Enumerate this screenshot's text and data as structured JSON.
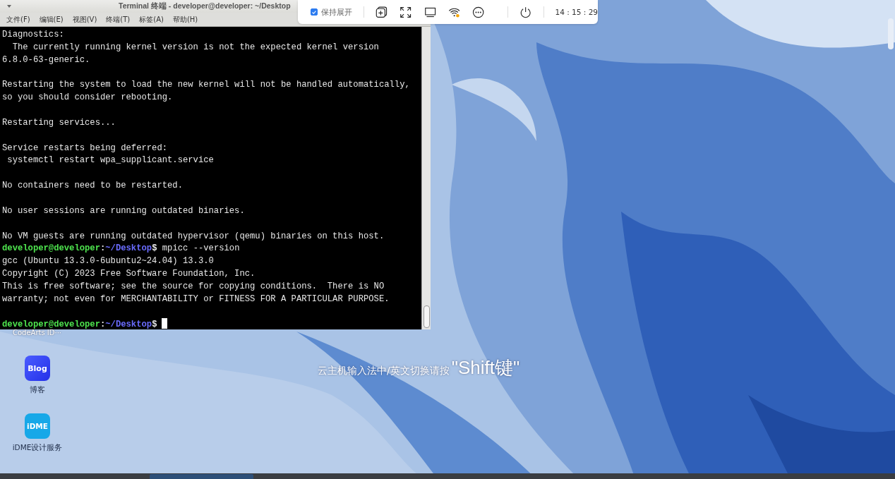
{
  "window": {
    "title": "Terminal 终端 - developer@developer: ~/Desktop",
    "menu": [
      "文件(F)",
      "编辑(E)",
      "视图(V)",
      "终端(T)",
      "标签(A)",
      "帮助(H)"
    ]
  },
  "terminal": {
    "lines": [
      {
        "kind": "text",
        "text": "Diagnostics:"
      },
      {
        "kind": "text",
        "text": "  The currently running kernel version is not the expected kernel version"
      },
      {
        "kind": "text",
        "text": "6.8.0-63-generic."
      },
      {
        "kind": "blank"
      },
      {
        "kind": "text",
        "text": "Restarting the system to load the new kernel will not be handled automatically,"
      },
      {
        "kind": "text",
        "text": "so you should consider rebooting."
      },
      {
        "kind": "blank"
      },
      {
        "kind": "text",
        "text": "Restarting services..."
      },
      {
        "kind": "blank"
      },
      {
        "kind": "text",
        "text": "Service restarts being deferred:"
      },
      {
        "kind": "text",
        "text": " systemctl restart wpa_supplicant.service"
      },
      {
        "kind": "blank"
      },
      {
        "kind": "text",
        "text": "No containers need to be restarted."
      },
      {
        "kind": "blank"
      },
      {
        "kind": "text",
        "text": "No user sessions are running outdated binaries."
      },
      {
        "kind": "blank"
      },
      {
        "kind": "text",
        "text": "No VM guests are running outdated hypervisor (qemu) binaries on this host."
      },
      {
        "kind": "prompt",
        "user": "developer@developer",
        "sep": ":",
        "path": "~/Desktop",
        "symbol": "$",
        "command": "mpicc --version"
      },
      {
        "kind": "text",
        "text": "gcc (Ubuntu 13.3.0-6ubuntu2~24.04) 13.3.0"
      },
      {
        "kind": "text",
        "text": "Copyright (C) 2023 Free Software Foundation, Inc."
      },
      {
        "kind": "text",
        "text": "This is free software; see the source for copying conditions.  There is NO"
      },
      {
        "kind": "text",
        "text": "warranty; not even for MERCHANTABILITY or FITNESS FOR A PARTICULAR PURPOSE."
      },
      {
        "kind": "blank"
      },
      {
        "kind": "prompt",
        "user": "developer@developer",
        "sep": ":",
        "path": "~/Desktop",
        "symbol": "$",
        "cursor": true
      }
    ]
  },
  "toolbar": {
    "keep_expanded": {
      "label": "保持展开",
      "checked": true
    },
    "clock": "14 : 15 : 29"
  },
  "desktop": {
    "hidden_icon_label": "CodeArts ID···",
    "icons": [
      {
        "kind": "blog",
        "glyph": "Blog",
        "label": "博客"
      },
      {
        "kind": "idme",
        "glyph": "iDME",
        "label": "iDME设计服务"
      }
    ],
    "ime_hint": {
      "text": "云主机输入法中/英文切换请按",
      "key": "\"Shift键\""
    }
  }
}
